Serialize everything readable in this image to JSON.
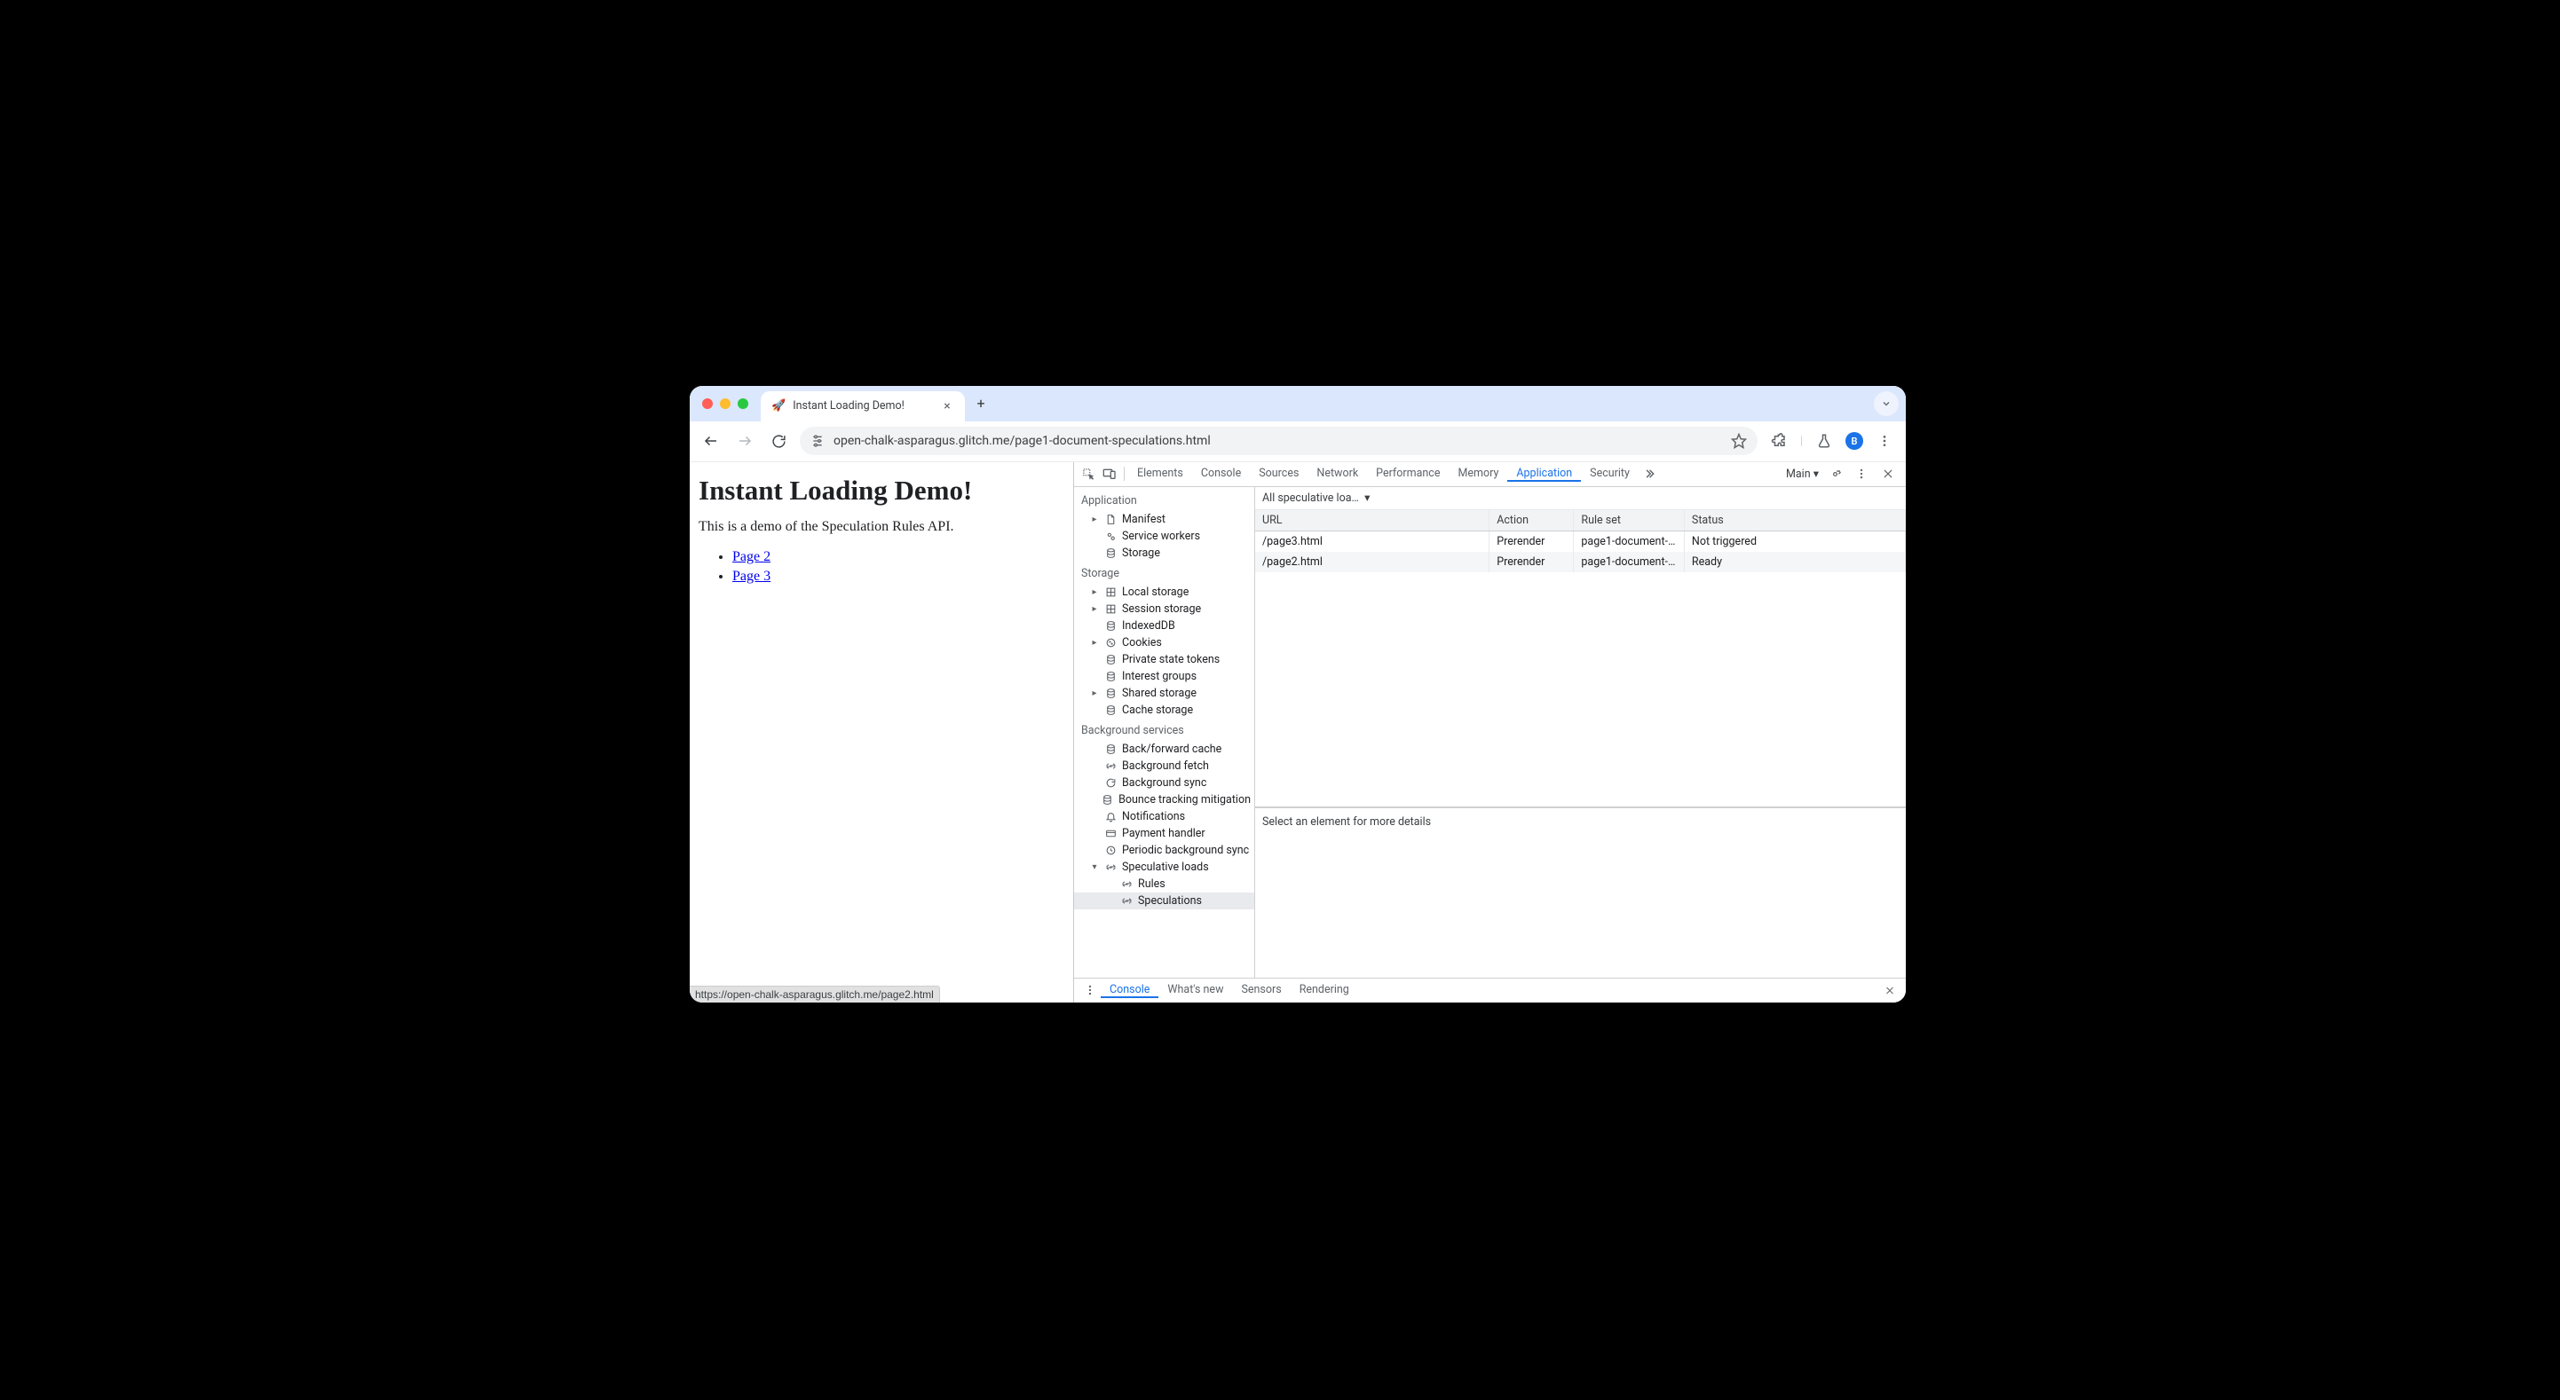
{
  "browser": {
    "tab_title": "Instant Loading Demo!",
    "favicon": "🚀",
    "url": "open-chalk-asparagus.glitch.me/page1-document-speculations.html",
    "avatar_letter": "B",
    "status_bar": "https://open-chalk-asparagus.glitch.me/page2.html"
  },
  "page": {
    "heading": "Instant Loading Demo!",
    "intro": "This is a demo of the Speculation Rules API.",
    "links": [
      {
        "label": "Page 2"
      },
      {
        "label": "Page 3"
      }
    ]
  },
  "devtools": {
    "tabs": [
      "Elements",
      "Console",
      "Sources",
      "Network",
      "Performance",
      "Memory",
      "Application",
      "Security"
    ],
    "active_tab": "Application",
    "target_label": "Main",
    "sidebar": {
      "sections": [
        {
          "title": "Application",
          "items": [
            {
              "label": "Manifest",
              "icon": "file",
              "expandable": true
            },
            {
              "label": "Service workers",
              "icon": "gears"
            },
            {
              "label": "Storage",
              "icon": "db"
            }
          ]
        },
        {
          "title": "Storage",
          "items": [
            {
              "label": "Local storage",
              "icon": "grid",
              "expandable": true
            },
            {
              "label": "Session storage",
              "icon": "grid",
              "expandable": true
            },
            {
              "label": "IndexedDB",
              "icon": "db"
            },
            {
              "label": "Cookies",
              "icon": "cookie",
              "expandable": true
            },
            {
              "label": "Private state tokens",
              "icon": "db"
            },
            {
              "label": "Interest groups",
              "icon": "db"
            },
            {
              "label": "Shared storage",
              "icon": "db",
              "expandable": true
            },
            {
              "label": "Cache storage",
              "icon": "db"
            }
          ]
        },
        {
          "title": "Background services",
          "items": [
            {
              "label": "Back/forward cache",
              "icon": "db"
            },
            {
              "label": "Background fetch",
              "icon": "sync"
            },
            {
              "label": "Background sync",
              "icon": "refresh"
            },
            {
              "label": "Bounce tracking mitigation",
              "icon": "db"
            },
            {
              "label": "Notifications",
              "icon": "bell"
            },
            {
              "label": "Payment handler",
              "icon": "card"
            },
            {
              "label": "Periodic background sync",
              "icon": "clock"
            },
            {
              "label": "Speculative loads",
              "icon": "sync",
              "expanded": true,
              "children": [
                {
                  "label": "Rules",
                  "icon": "sync"
                },
                {
                  "label": "Speculations",
                  "icon": "sync",
                  "selected": true
                }
              ]
            }
          ]
        }
      ]
    },
    "filter_label": "All speculative loa…",
    "table": {
      "headers": [
        "URL",
        "Action",
        "Rule set",
        "Status"
      ],
      "rows": [
        {
          "url": "/page3.html",
          "action": "Prerender",
          "ruleset": "page1-document-…",
          "status": "Not triggered"
        },
        {
          "url": "/page2.html",
          "action": "Prerender",
          "ruleset": "page1-document-…",
          "status": "Ready"
        }
      ]
    },
    "details_placeholder": "Select an element for more details",
    "drawer_tabs": [
      "Console",
      "What's new",
      "Sensors",
      "Rendering"
    ],
    "drawer_active": "Console"
  }
}
